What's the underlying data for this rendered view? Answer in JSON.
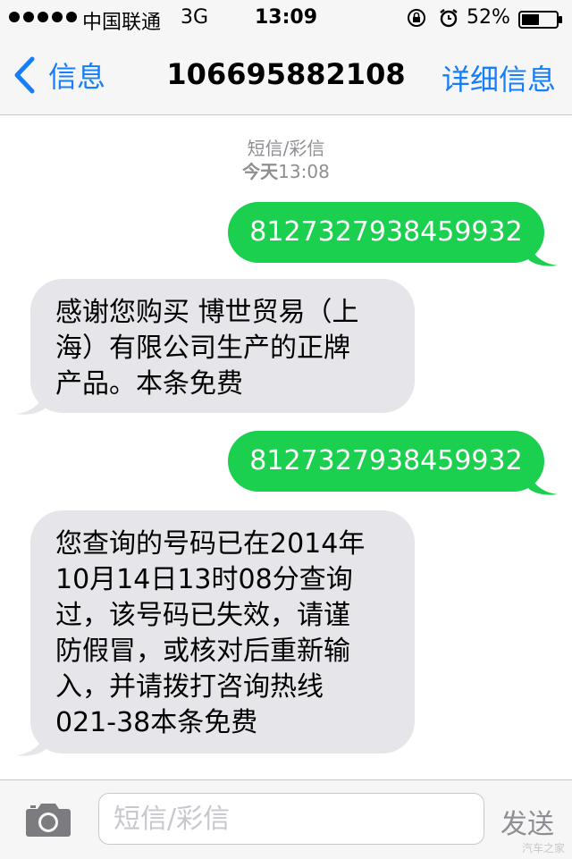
{
  "status_bar": {
    "carrier": "中国联通",
    "network": "3G",
    "time": "13:09",
    "battery_percent": "52%",
    "battery_level": 0.52,
    "icons": [
      "signal-dots-icon",
      "rotation-lock-icon",
      "alarm-icon",
      "battery-icon"
    ]
  },
  "nav": {
    "back_label": "信息",
    "title": "106695882108",
    "details_label": "详细信息",
    "accent_color": "#157efb"
  },
  "thread": {
    "service": "短信/彩信",
    "day": "今天",
    "time": "13:08",
    "messages": [
      {
        "direction": "outgoing",
        "text": "8127327938459932"
      },
      {
        "direction": "incoming",
        "lines": [
          "感谢您购买 博世贸易（上",
          "海）有限公司生产的正牌",
          "产品。本条免费"
        ]
      },
      {
        "direction": "outgoing",
        "text": "8127327938459932"
      },
      {
        "direction": "incoming",
        "lines": [
          "您查询的号码已在2014年",
          "10月14日13时08分查询",
          "过，该号码已失效，请谨",
          "防假冒，或核对后重新输",
          "入，并请拨打咨询热线",
          "021-38本条免费"
        ]
      }
    ],
    "outgoing_color": "#1bd04e",
    "incoming_color": "#e5e5ea"
  },
  "input_bar": {
    "placeholder": "短信/彩信",
    "value": "",
    "send_label": "发送"
  },
  "watermark": "汽车之家"
}
